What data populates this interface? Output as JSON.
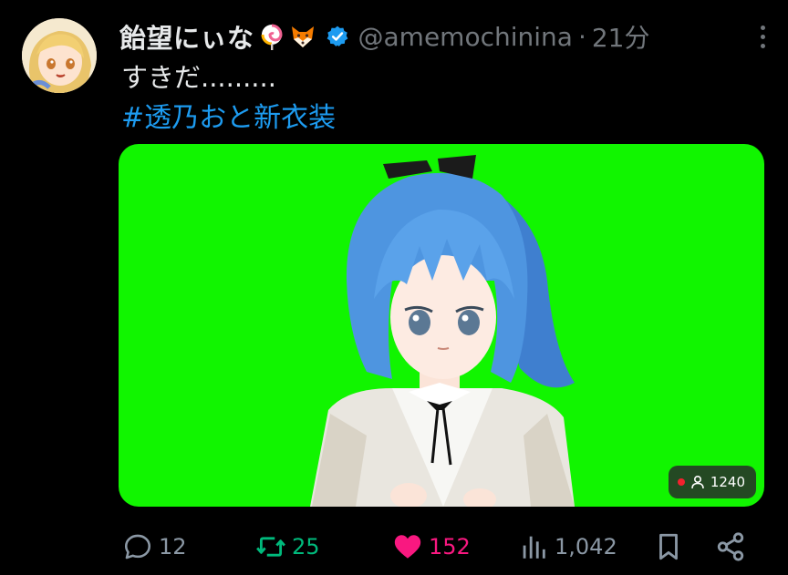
{
  "author": {
    "display_name": "飴望にぃな",
    "emoji": [
      "lollipop-emoji",
      "fox-emoji"
    ],
    "verified": true,
    "handle": "@amemochinina",
    "separator": "·",
    "time": "21分"
  },
  "tweet": {
    "text": "すきだ.........",
    "hashtag": "#透乃おと新衣装"
  },
  "media": {
    "type": "live-video",
    "background": "#11f500",
    "viewer_count": "1240"
  },
  "actions": {
    "reply_count": "12",
    "retweet_count": "25",
    "like_count": "152",
    "view_count": "1,042"
  },
  "colors": {
    "background": "#000000",
    "text": "#e7e9ea",
    "muted": "#71767b",
    "link": "#1d9bf0",
    "retweet": "#00ba7c",
    "like": "#f91880",
    "live": "#f4212e"
  }
}
